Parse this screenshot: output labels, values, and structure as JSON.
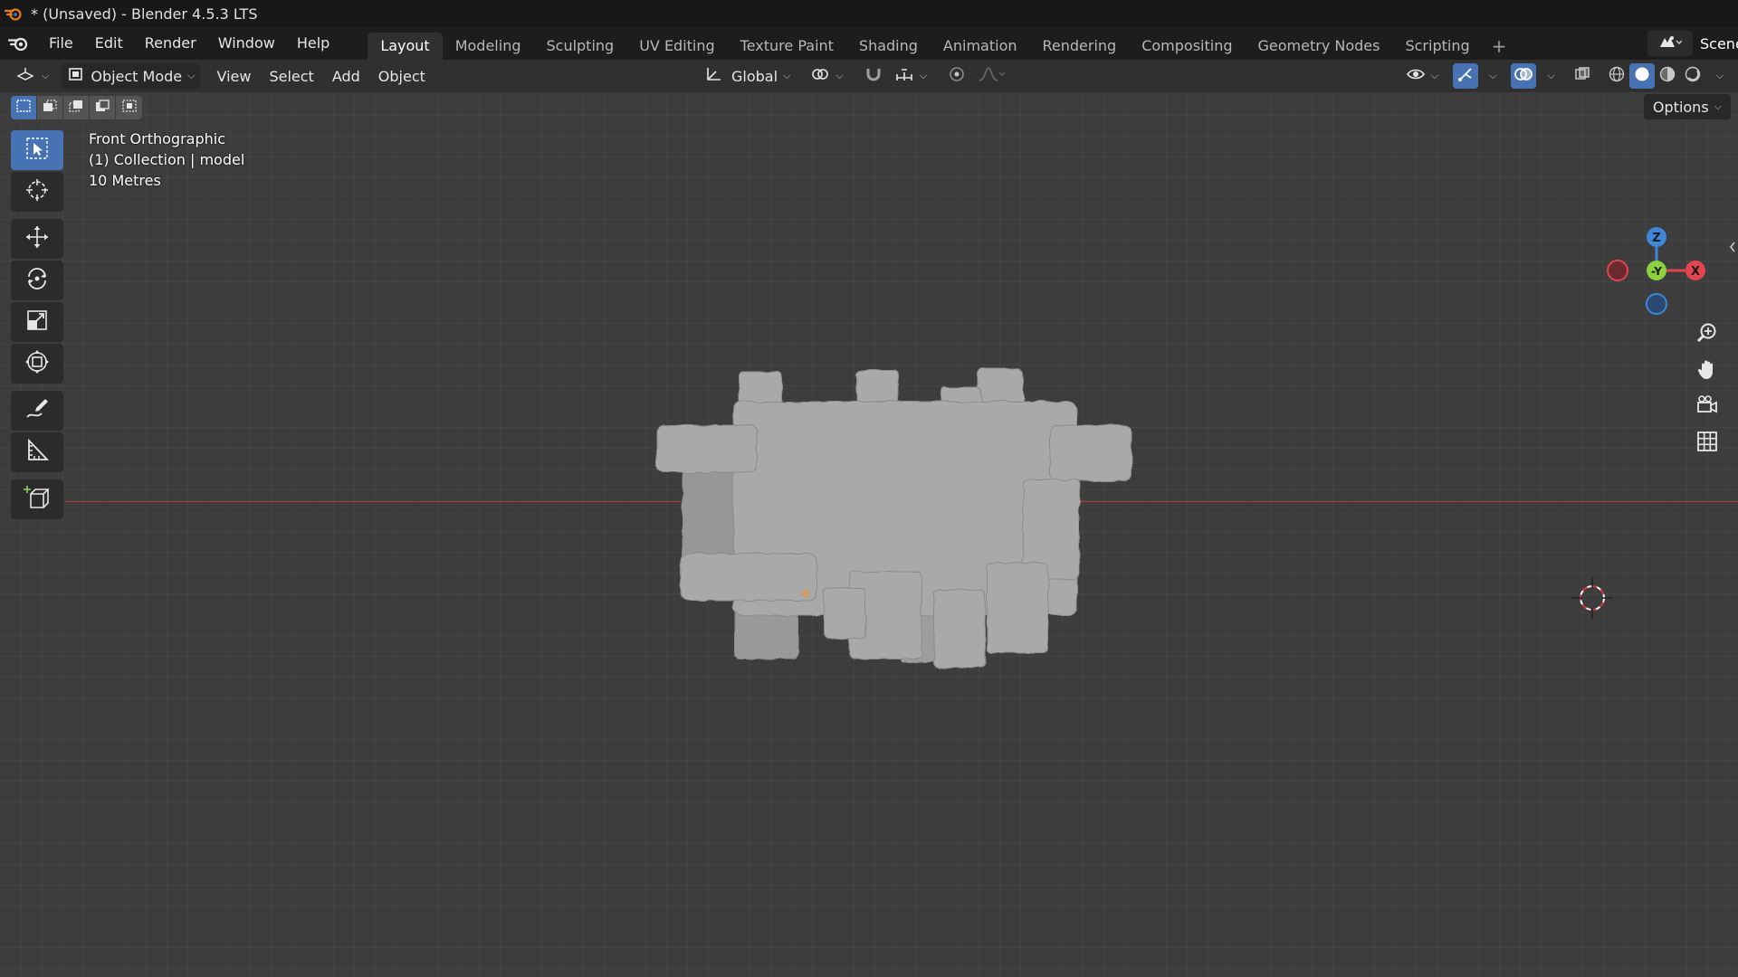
{
  "window": {
    "title": "* (Unsaved) - Blender 4.5.3 LTS"
  },
  "menus": [
    "File",
    "Edit",
    "Render",
    "Window",
    "Help"
  ],
  "workspace_tabs": [
    {
      "label": "Layout",
      "active": true
    },
    {
      "label": "Modeling",
      "active": false
    },
    {
      "label": "Sculpting",
      "active": false
    },
    {
      "label": "UV Editing",
      "active": false
    },
    {
      "label": "Texture Paint",
      "active": false
    },
    {
      "label": "Shading",
      "active": false
    },
    {
      "label": "Animation",
      "active": false
    },
    {
      "label": "Rendering",
      "active": false
    },
    {
      "label": "Compositing",
      "active": false
    },
    {
      "label": "Geometry Nodes",
      "active": false
    },
    {
      "label": "Scripting",
      "active": false
    }
  ],
  "topbar_right": {
    "scene_label": "Scene"
  },
  "viewport_header": {
    "mode": "Object Mode",
    "menus": [
      "View",
      "Select",
      "Add",
      "Object"
    ],
    "transform_orientation": "Global"
  },
  "options_label": "Options",
  "overlay": {
    "view_name": "Front Orthographic",
    "collection": "(1) Collection | model",
    "scale": "10 Metres"
  },
  "gizmo": {
    "z": "Z",
    "y": "-Y",
    "x": "X"
  },
  "colors": {
    "accent": "#4772b3",
    "x_axis": "#e2454f",
    "y_axis": "#8bd13f",
    "z_axis": "#3e86d6",
    "model": "#a9a9a9"
  }
}
